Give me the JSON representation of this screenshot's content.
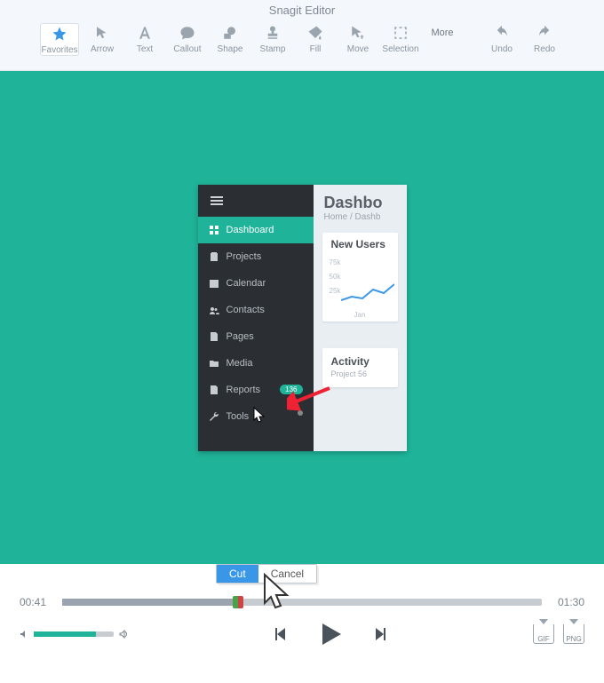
{
  "app_title": "Snagit Editor",
  "toolbar": {
    "favorites": "Favorites",
    "arrow": "Arrow",
    "text": "Text",
    "callout": "Callout",
    "shape": "Shape",
    "stamp": "Stamp",
    "fill": "Fill",
    "move": "Move",
    "selection": "Selection",
    "more": "More",
    "undo": "Undo",
    "redo": "Redo"
  },
  "preview": {
    "sidebar": {
      "items": [
        {
          "label": "Dashboard"
        },
        {
          "label": "Projects"
        },
        {
          "label": "Calendar"
        },
        {
          "label": "Contacts"
        },
        {
          "label": "Pages"
        },
        {
          "label": "Media"
        },
        {
          "label": "Reports",
          "badge": "136"
        },
        {
          "label": "Tools"
        }
      ]
    },
    "header": {
      "title": "Dashbo",
      "breadcrumb": "Home / Dashb"
    },
    "users_card": {
      "title": "New Users"
    },
    "activity_card": {
      "title": "Activity",
      "subtitle": "Project 56"
    }
  },
  "chart_data": {
    "type": "line",
    "title": "New Users",
    "xlabel": "Jan",
    "y_ticks": [
      "75k",
      "50k",
      "25k"
    ],
    "x": [
      0,
      1,
      2,
      3,
      4,
      5
    ],
    "values": [
      18,
      22,
      20,
      30,
      26,
      34
    ],
    "ylim": [
      0,
      75
    ]
  },
  "timeline": {
    "current": "00:41",
    "total": "01:30",
    "popup": {
      "cut": "Cut",
      "cancel": "Cancel"
    }
  },
  "export": {
    "gif": "GIF",
    "png": "PNG"
  }
}
